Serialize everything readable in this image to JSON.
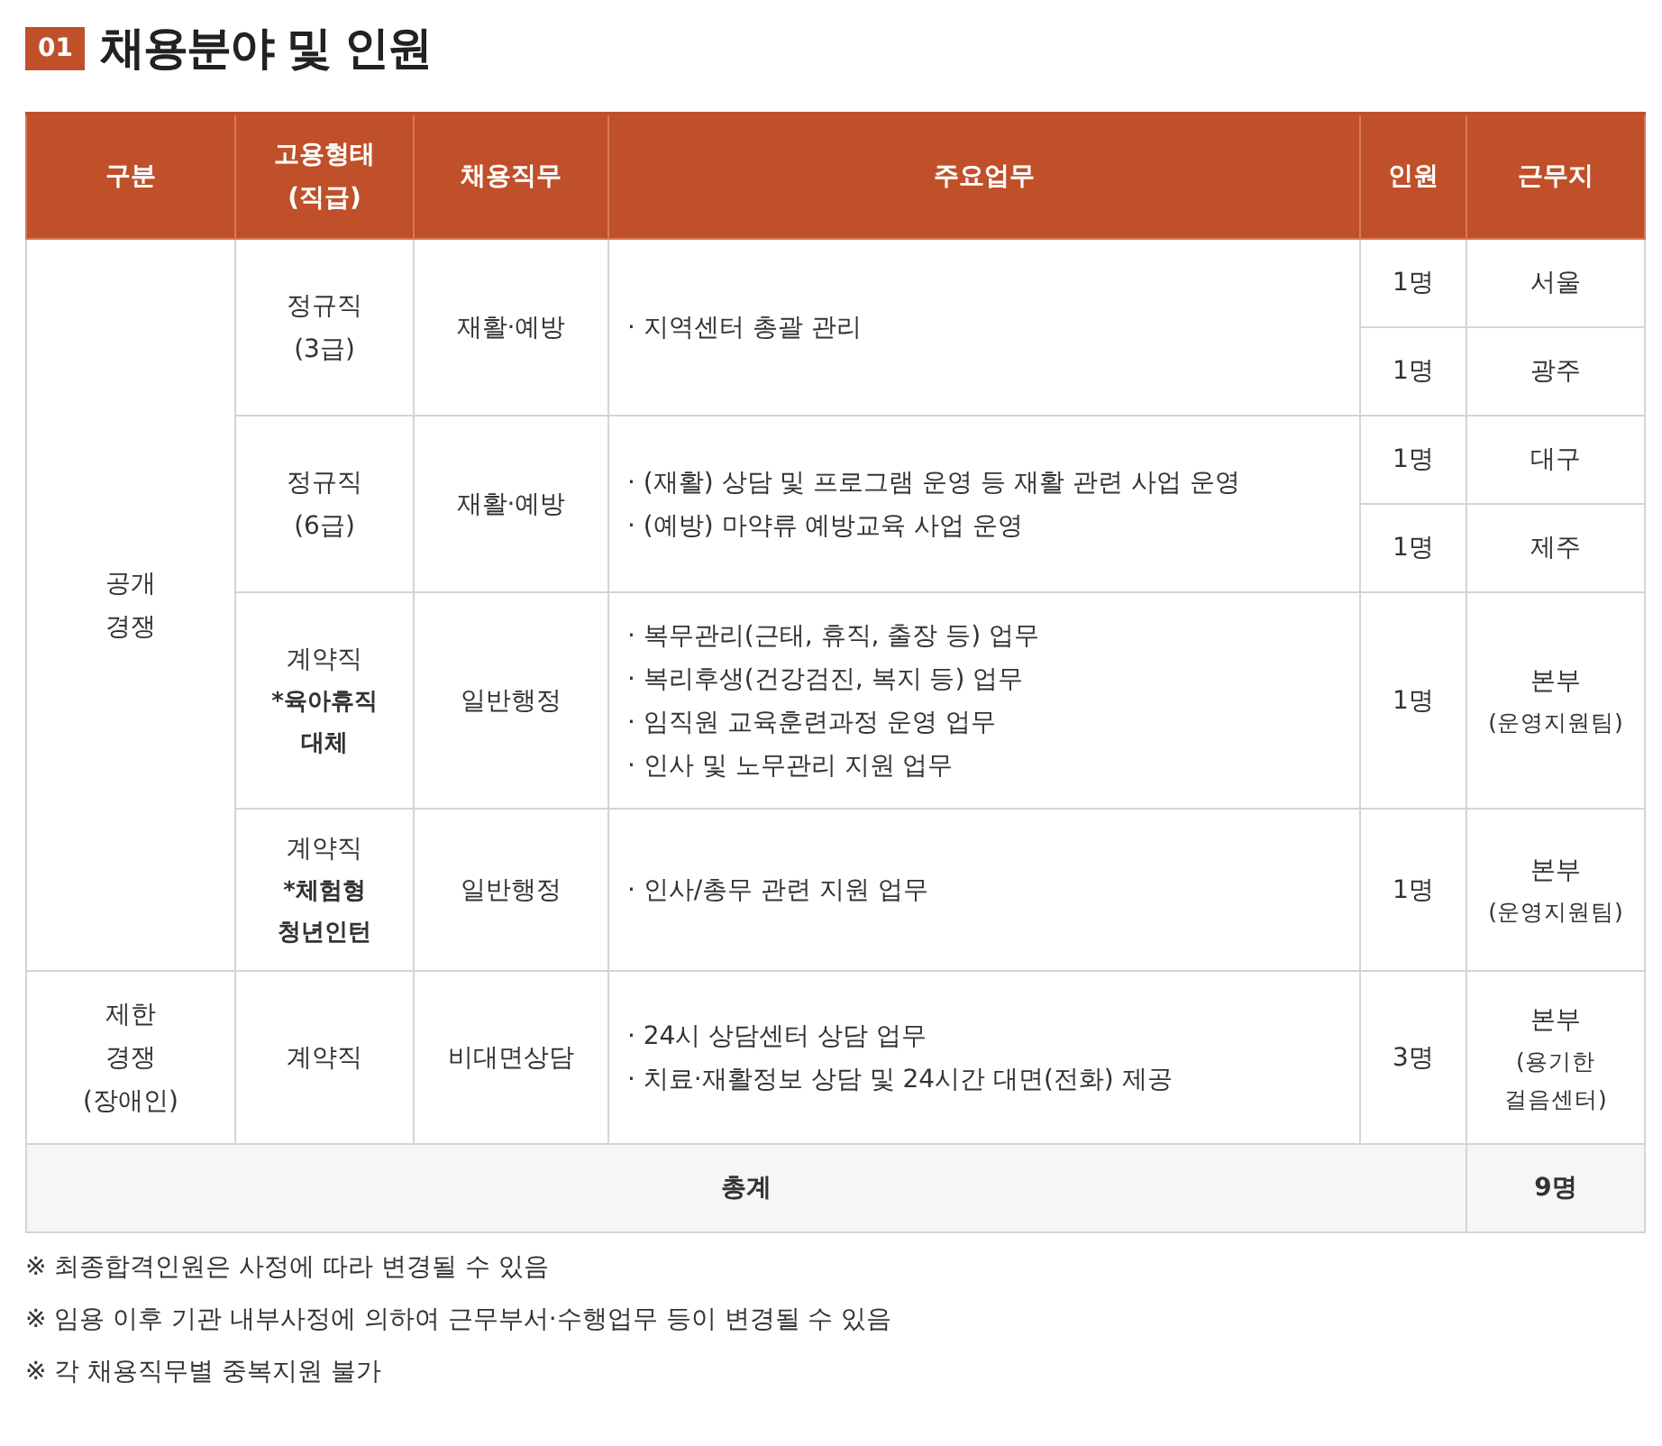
{
  "heading": {
    "number": "01",
    "title": "채용분야 및 인원"
  },
  "table": {
    "columns": [
      "구분",
      "고용형태\n(직급)",
      "채용직무",
      "주요업무",
      "인원",
      "근무지"
    ],
    "groups": [
      {
        "category": "공개\n경쟁",
        "positions": [
          {
            "type": "정규직\n(3급)",
            "job": "재활·예방",
            "duties": [
              "· 지역센터 총괄 관리"
            ],
            "offices": [
              {
                "count": "1명",
                "location": "서울"
              },
              {
                "count": "1명",
                "location": "광주"
              }
            ]
          },
          {
            "type": "정규직\n(6급)",
            "job": "재활·예방",
            "duties": [
              "· (재활) 상담 및 프로그램 운영 등 재활 관련 사업 운영",
              "· (예방) 마약류 예방교육 사업 운영"
            ],
            "offices": [
              {
                "count": "1명",
                "location": "대구"
              },
              {
                "count": "1명",
                "location": "제주"
              }
            ]
          },
          {
            "type": "계약직",
            "type_note": "*육아휴직\n대체",
            "job": "일반행정",
            "duties": [
              "· 복무관리(근태, 휴직, 출장 등) 업무",
              "· 복리후생(건강검진, 복지 등) 업무",
              "· 임직원 교육훈련과정 운영 업무",
              "· 인사 및 노무관리 지원 업무"
            ],
            "offices": [
              {
                "count": "1명",
                "location": "본부",
                "location_note": "(운영지원팀)"
              }
            ]
          },
          {
            "type": "계약직",
            "type_note": "*체험형\n청년인턴",
            "job": "일반행정",
            "duties": [
              "· 인사/총무 관련 지원 업무"
            ],
            "offices": [
              {
                "count": "1명",
                "location": "본부",
                "location_note": "(운영지원팀)"
              }
            ]
          }
        ]
      },
      {
        "category": "제한\n경쟁\n(장애인)",
        "positions": [
          {
            "type": "계약직",
            "job": "비대면상담",
            "duties": [
              "· 24시 상담센터 상담 업무",
              "· 치료·재활정보 상담 및 24시간 대면(전화) 제공"
            ],
            "offices": [
              {
                "count": "3명",
                "location": "본부",
                "location_note": "(용기한\n걸음센터)"
              }
            ]
          }
        ]
      }
    ],
    "total": {
      "label": "총계",
      "value": "9명"
    }
  },
  "notes": [
    "※ 최종합격인원은 사정에 따라 변경될 수 있음",
    "※ 임용 이후 기관 내부사정에 의하여 근무부서·수행업무 등이 변경될 수 있음",
    "※ 각 채용직무별 중복지원 불가"
  ]
}
